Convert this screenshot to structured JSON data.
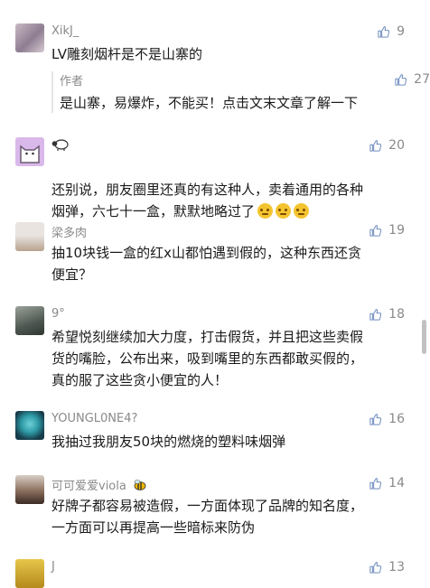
{
  "comments": [
    {
      "name": "XikJ_",
      "likes": "9",
      "text": "LV雕刻烟杆是不是山寨的",
      "reply": {
        "name": "作者",
        "likes": "27",
        "text": "是山寨，易爆炸，不能买！点击文末文章了解一下"
      }
    },
    {
      "name": "",
      "likes": "20",
      "text": "还别说，朋友圈里还真的有这种人，卖着通用的各种\n烟弹，六七十一盒，默默地略过了"
    },
    {
      "name": "梁多肉",
      "likes": "19",
      "text": "抽10块钱一盒的红x山都怕遇到假的，这种东西还贪\n便宜？"
    },
    {
      "name": "9°",
      "likes": "18",
      "text": "希望悦刻继续加大力度，打击假货，并且把这些卖假\n货的嘴脸，公布出来，吸到嘴里的东西都敢买假的，\n真的服了这些贪小便宜的人！"
    },
    {
      "name": "YOUNGL0NE4?",
      "likes": "16",
      "text": "我抽过我朋友50块的燃烧的塑料味烟弹"
    },
    {
      "name": "可可爱爱viola",
      "likes": "14",
      "text": "好牌子都容易被造假，一方面体现了品牌的知名度，\n一方面可以再提高一些暗标来防伪"
    },
    {
      "name": "J",
      "likes": "13",
      "text": ""
    }
  ],
  "icons": {
    "like": "thumbs-up-icon",
    "emoji": "pleading-face-emoji",
    "sheep": "sheep-icon",
    "bee": "bee-icon"
  },
  "colors": {
    "meta": "#8a8a8a",
    "text": "#1a1a1a",
    "reply_bar": "#e4e4e4"
  }
}
